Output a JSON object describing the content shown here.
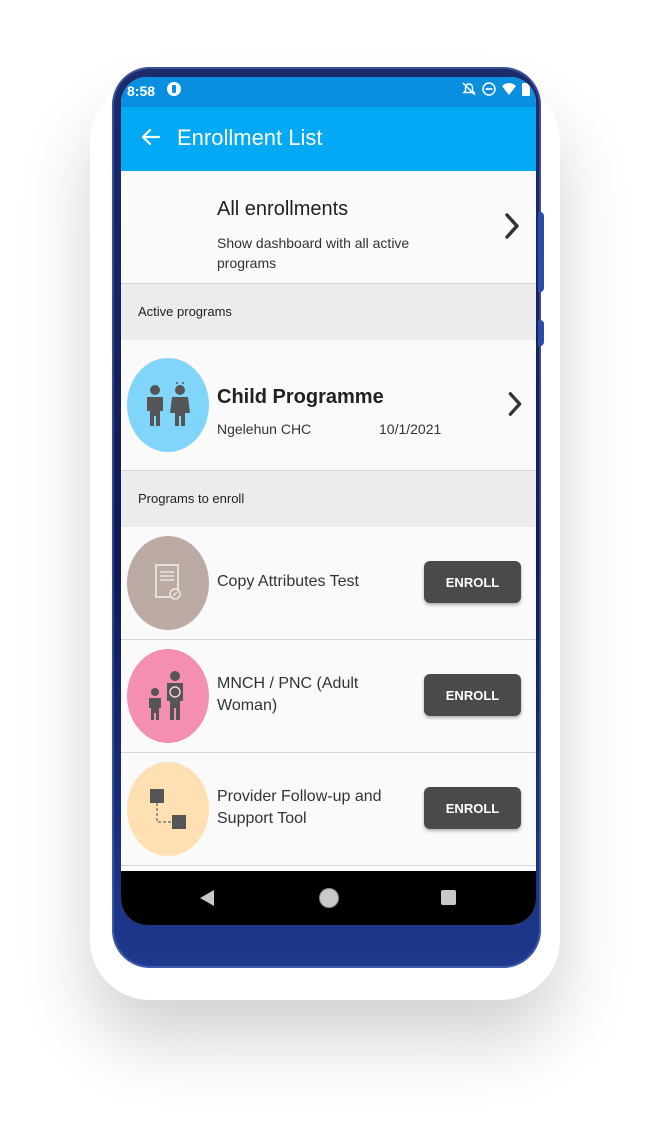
{
  "status_bar": {
    "time": "8:58"
  },
  "app_bar": {
    "title": "Enrollment List"
  },
  "all_enrollments": {
    "title": "All enrollments",
    "subtitle": "Show dashboard with all active programs"
  },
  "active_programs": {
    "header": "Active programs",
    "items": [
      {
        "name": "Child Programme",
        "org_unit": "Ngelehun CHC",
        "date": "10/1/2021",
        "avatar_color": "#81d4fa",
        "icon": "children-icon"
      }
    ]
  },
  "programs_to_enroll": {
    "header": "Programs to enroll",
    "items": [
      {
        "name": "Copy Attributes Test",
        "button": "ENROLL",
        "avatar_color": "#bcaaa4",
        "icon": "document-icon"
      },
      {
        "name": "MNCH / PNC (Adult Woman)",
        "button": "ENROLL",
        "avatar_color": "#f48fb1",
        "icon": "mother-child-icon"
      },
      {
        "name": "Provider Follow-up and Support Tool",
        "button": "ENROLL",
        "avatar_color": "#ffe0b2",
        "icon": "flow-icon"
      }
    ]
  },
  "colors": {
    "status_bar": "#0a8fe0",
    "app_bar": "#03a9f4",
    "button": "#4a4a4a"
  }
}
